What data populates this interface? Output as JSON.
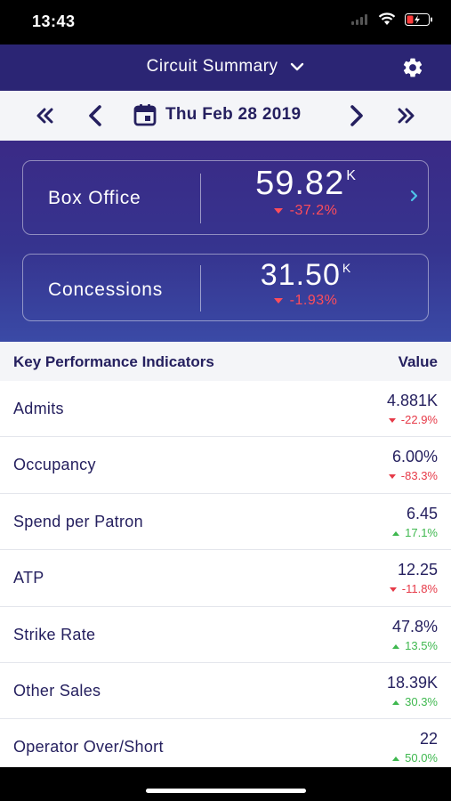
{
  "status_bar": {
    "time": "13:43"
  },
  "header": {
    "title": "Circuit Summary"
  },
  "date_nav": {
    "date": "Thu Feb 28 2019"
  },
  "summary_cards": [
    {
      "label": "Box Office",
      "value": "59.82",
      "unit": "K",
      "change": "-37.2%"
    },
    {
      "label": "Concessions",
      "value": "31.50",
      "unit": "K",
      "change": "-1.93%"
    }
  ],
  "kpi": {
    "header_label": "Key Performance Indicators",
    "header_value": "Value",
    "rows": [
      {
        "name": "Admits",
        "value": "4.881K",
        "change": "-22.9%",
        "trend": "down"
      },
      {
        "name": "Occupancy",
        "value": "6.00%",
        "change": "-83.3%",
        "trend": "down"
      },
      {
        "name": "Spend per Patron",
        "value": "6.45",
        "change": "17.1%",
        "trend": "up"
      },
      {
        "name": "ATP",
        "value": "12.25",
        "change": "-11.8%",
        "trend": "down"
      },
      {
        "name": "Strike Rate",
        "value": "47.8%",
        "change": "13.5%",
        "trend": "up"
      },
      {
        "name": "Other Sales",
        "value": "18.39K",
        "change": "30.3%",
        "trend": "up"
      },
      {
        "name": "Operator Over/Short",
        "value": "22",
        "change": "50.0%",
        "trend": "up"
      }
    ]
  },
  "colors": {
    "header_bg": "#2b2574",
    "navy_text": "#25205f",
    "negative": "#e63a48",
    "positive": "#3fb84f",
    "accent_arrow": "#4fc3e8"
  }
}
